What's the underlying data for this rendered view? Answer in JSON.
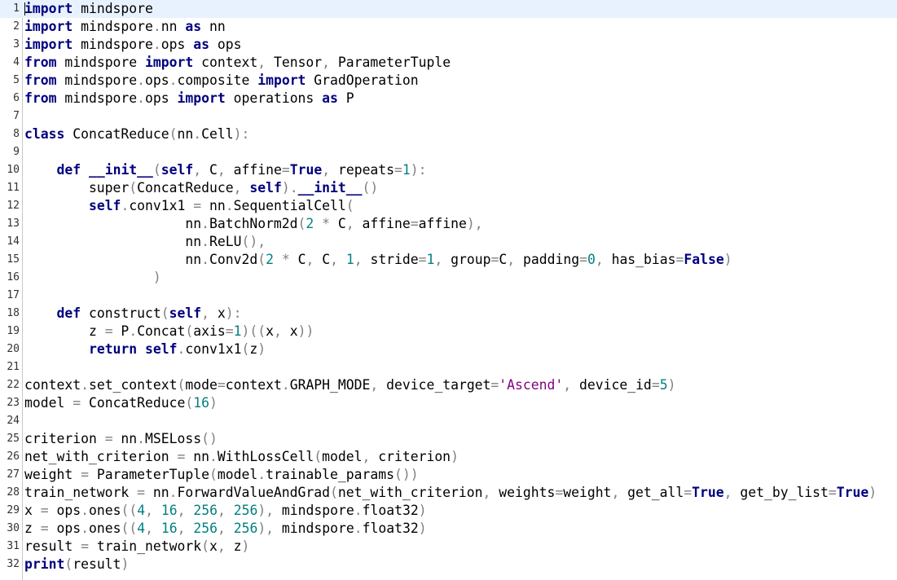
{
  "editor": {
    "current_line": 1,
    "colors": {
      "keyword": "#00007f",
      "operator": "#808080",
      "number": "#007f7f",
      "string": "#7f007f",
      "current_line_bg": "#e8f2fe"
    },
    "lines": [
      {
        "n": "1",
        "tokens": [
          [
            "kw",
            "import"
          ],
          [
            "pl",
            " mindspore"
          ]
        ]
      },
      {
        "n": "2",
        "tokens": [
          [
            "kw",
            "import"
          ],
          [
            "pl",
            " mindspore"
          ],
          [
            "op",
            "."
          ],
          [
            "pl",
            "nn "
          ],
          [
            "kw",
            "as"
          ],
          [
            "pl",
            " nn"
          ]
        ]
      },
      {
        "n": "3",
        "tokens": [
          [
            "kw",
            "import"
          ],
          [
            "pl",
            " mindspore"
          ],
          [
            "op",
            "."
          ],
          [
            "pl",
            "ops "
          ],
          [
            "kw",
            "as"
          ],
          [
            "pl",
            " ops"
          ]
        ]
      },
      {
        "n": "4",
        "tokens": [
          [
            "kw",
            "from"
          ],
          [
            "pl",
            " mindspore "
          ],
          [
            "kw",
            "import"
          ],
          [
            "pl",
            " context"
          ],
          [
            "op",
            ","
          ],
          [
            "pl",
            " Tensor"
          ],
          [
            "op",
            ","
          ],
          [
            "pl",
            " ParameterTuple"
          ]
        ]
      },
      {
        "n": "5",
        "tokens": [
          [
            "kw",
            "from"
          ],
          [
            "pl",
            " mindspore"
          ],
          [
            "op",
            "."
          ],
          [
            "pl",
            "ops"
          ],
          [
            "op",
            "."
          ],
          [
            "pl",
            "composite "
          ],
          [
            "kw",
            "import"
          ],
          [
            "pl",
            " GradOperation"
          ]
        ]
      },
      {
        "n": "6",
        "tokens": [
          [
            "kw",
            "from"
          ],
          [
            "pl",
            " mindspore"
          ],
          [
            "op",
            "."
          ],
          [
            "pl",
            "ops "
          ],
          [
            "kw",
            "import"
          ],
          [
            "pl",
            " operations "
          ],
          [
            "kw",
            "as"
          ],
          [
            "pl",
            " P"
          ]
        ]
      },
      {
        "n": "7",
        "tokens": []
      },
      {
        "n": "8",
        "tokens": [
          [
            "kw",
            "class"
          ],
          [
            "pl",
            " ConcatReduce"
          ],
          [
            "op",
            "("
          ],
          [
            "pl",
            "nn"
          ],
          [
            "op",
            "."
          ],
          [
            "pl",
            "Cell"
          ],
          [
            "op",
            "):"
          ]
        ]
      },
      {
        "n": "9",
        "tokens": []
      },
      {
        "n": "10",
        "tokens": [
          [
            "pl",
            "    "
          ],
          [
            "kw",
            "def"
          ],
          [
            "pl",
            " "
          ],
          [
            "kw",
            "__init__"
          ],
          [
            "op",
            "("
          ],
          [
            "kw",
            "self"
          ],
          [
            "op",
            ","
          ],
          [
            "pl",
            " C"
          ],
          [
            "op",
            ","
          ],
          [
            "pl",
            " affine"
          ],
          [
            "op",
            "="
          ],
          [
            "kw",
            "True"
          ],
          [
            "op",
            ","
          ],
          [
            "pl",
            " repeats"
          ],
          [
            "op",
            "="
          ],
          [
            "num",
            "1"
          ],
          [
            "op",
            "):"
          ]
        ]
      },
      {
        "n": "11",
        "tokens": [
          [
            "pl",
            "        super"
          ],
          [
            "op",
            "("
          ],
          [
            "pl",
            "ConcatReduce"
          ],
          [
            "op",
            ","
          ],
          [
            "pl",
            " "
          ],
          [
            "kw",
            "self"
          ],
          [
            "op",
            ")."
          ],
          [
            "kw",
            "__init__"
          ],
          [
            "op",
            "()"
          ]
        ]
      },
      {
        "n": "12",
        "tokens": [
          [
            "pl",
            "        "
          ],
          [
            "kw",
            "self"
          ],
          [
            "op",
            "."
          ],
          [
            "pl",
            "conv1x1 "
          ],
          [
            "op",
            "="
          ],
          [
            "pl",
            " nn"
          ],
          [
            "op",
            "."
          ],
          [
            "pl",
            "SequentialCell"
          ],
          [
            "op",
            "("
          ]
        ]
      },
      {
        "n": "13",
        "tokens": [
          [
            "pl",
            "                    nn"
          ],
          [
            "op",
            "."
          ],
          [
            "pl",
            "BatchNorm2d"
          ],
          [
            "op",
            "("
          ],
          [
            "num",
            "2"
          ],
          [
            "pl",
            " "
          ],
          [
            "op",
            "*"
          ],
          [
            "pl",
            " C"
          ],
          [
            "op",
            ","
          ],
          [
            "pl",
            " affine"
          ],
          [
            "op",
            "="
          ],
          [
            "pl",
            "affine"
          ],
          [
            "op",
            "),"
          ]
        ]
      },
      {
        "n": "14",
        "tokens": [
          [
            "pl",
            "                    nn"
          ],
          [
            "op",
            "."
          ],
          [
            "pl",
            "ReLU"
          ],
          [
            "op",
            "(),"
          ]
        ]
      },
      {
        "n": "15",
        "tokens": [
          [
            "pl",
            "                    nn"
          ],
          [
            "op",
            "."
          ],
          [
            "pl",
            "Conv2d"
          ],
          [
            "op",
            "("
          ],
          [
            "num",
            "2"
          ],
          [
            "pl",
            " "
          ],
          [
            "op",
            "*"
          ],
          [
            "pl",
            " C"
          ],
          [
            "op",
            ","
          ],
          [
            "pl",
            " C"
          ],
          [
            "op",
            ","
          ],
          [
            "pl",
            " "
          ],
          [
            "num",
            "1"
          ],
          [
            "op",
            ","
          ],
          [
            "pl",
            " stride"
          ],
          [
            "op",
            "="
          ],
          [
            "num",
            "1"
          ],
          [
            "op",
            ","
          ],
          [
            "pl",
            " group"
          ],
          [
            "op",
            "="
          ],
          [
            "pl",
            "C"
          ],
          [
            "op",
            ","
          ],
          [
            "pl",
            " padding"
          ],
          [
            "op",
            "="
          ],
          [
            "num",
            "0"
          ],
          [
            "op",
            ","
          ],
          [
            "pl",
            " has_bias"
          ],
          [
            "op",
            "="
          ],
          [
            "kw",
            "False"
          ],
          [
            "op",
            ")"
          ]
        ]
      },
      {
        "n": "16",
        "tokens": [
          [
            "pl",
            "                "
          ],
          [
            "op",
            ")"
          ]
        ]
      },
      {
        "n": "17",
        "tokens": []
      },
      {
        "n": "18",
        "tokens": [
          [
            "pl",
            "    "
          ],
          [
            "kw",
            "def"
          ],
          [
            "pl",
            " construct"
          ],
          [
            "op",
            "("
          ],
          [
            "kw",
            "self"
          ],
          [
            "op",
            ","
          ],
          [
            "pl",
            " x"
          ],
          [
            "op",
            "):"
          ]
        ]
      },
      {
        "n": "19",
        "tokens": [
          [
            "pl",
            "        z "
          ],
          [
            "op",
            "="
          ],
          [
            "pl",
            " P"
          ],
          [
            "op",
            "."
          ],
          [
            "pl",
            "Concat"
          ],
          [
            "op",
            "("
          ],
          [
            "pl",
            "axis"
          ],
          [
            "op",
            "="
          ],
          [
            "num",
            "1"
          ],
          [
            "op",
            ")(("
          ],
          [
            "pl",
            "x"
          ],
          [
            "op",
            ","
          ],
          [
            "pl",
            " x"
          ],
          [
            "op",
            "))"
          ]
        ]
      },
      {
        "n": "20",
        "tokens": [
          [
            "pl",
            "        "
          ],
          [
            "kw",
            "return"
          ],
          [
            "pl",
            " "
          ],
          [
            "kw",
            "self"
          ],
          [
            "op",
            "."
          ],
          [
            "pl",
            "conv1x1"
          ],
          [
            "op",
            "("
          ],
          [
            "pl",
            "z"
          ],
          [
            "op",
            ")"
          ]
        ]
      },
      {
        "n": "21",
        "tokens": []
      },
      {
        "n": "22",
        "tokens": [
          [
            "pl",
            "context"
          ],
          [
            "op",
            "."
          ],
          [
            "pl",
            "set_context"
          ],
          [
            "op",
            "("
          ],
          [
            "pl",
            "mode"
          ],
          [
            "op",
            "="
          ],
          [
            "pl",
            "context"
          ],
          [
            "op",
            "."
          ],
          [
            "pl",
            "GRAPH_MODE"
          ],
          [
            "op",
            ","
          ],
          [
            "pl",
            " device_target"
          ],
          [
            "op",
            "="
          ],
          [
            "str",
            "'Ascend'"
          ],
          [
            "op",
            ","
          ],
          [
            "pl",
            " device_id"
          ],
          [
            "op",
            "="
          ],
          [
            "num",
            "5"
          ],
          [
            "op",
            ")"
          ]
        ]
      },
      {
        "n": "23",
        "tokens": [
          [
            "pl",
            "model "
          ],
          [
            "op",
            "="
          ],
          [
            "pl",
            " ConcatReduce"
          ],
          [
            "op",
            "("
          ],
          [
            "num",
            "16"
          ],
          [
            "op",
            ")"
          ]
        ]
      },
      {
        "n": "24",
        "tokens": []
      },
      {
        "n": "25",
        "tokens": [
          [
            "pl",
            "criterion "
          ],
          [
            "op",
            "="
          ],
          [
            "pl",
            " nn"
          ],
          [
            "op",
            "."
          ],
          [
            "pl",
            "MSELoss"
          ],
          [
            "op",
            "()"
          ]
        ]
      },
      {
        "n": "26",
        "tokens": [
          [
            "pl",
            "net_with_criterion "
          ],
          [
            "op",
            "="
          ],
          [
            "pl",
            " nn"
          ],
          [
            "op",
            "."
          ],
          [
            "pl",
            "WithLossCell"
          ],
          [
            "op",
            "("
          ],
          [
            "pl",
            "model"
          ],
          [
            "op",
            ","
          ],
          [
            "pl",
            " criterion"
          ],
          [
            "op",
            ")"
          ]
        ]
      },
      {
        "n": "27",
        "tokens": [
          [
            "pl",
            "weight "
          ],
          [
            "op",
            "="
          ],
          [
            "pl",
            " ParameterTuple"
          ],
          [
            "op",
            "("
          ],
          [
            "pl",
            "model"
          ],
          [
            "op",
            "."
          ],
          [
            "pl",
            "trainable_params"
          ],
          [
            "op",
            "())"
          ]
        ]
      },
      {
        "n": "28",
        "tokens": [
          [
            "pl",
            "train_network "
          ],
          [
            "op",
            "="
          ],
          [
            "pl",
            " nn"
          ],
          [
            "op",
            "."
          ],
          [
            "pl",
            "ForwardValueAndGrad"
          ],
          [
            "op",
            "("
          ],
          [
            "pl",
            "net_with_criterion"
          ],
          [
            "op",
            ","
          ],
          [
            "pl",
            " weights"
          ],
          [
            "op",
            "="
          ],
          [
            "pl",
            "weight"
          ],
          [
            "op",
            ","
          ],
          [
            "pl",
            " get_all"
          ],
          [
            "op",
            "="
          ],
          [
            "kw",
            "True"
          ],
          [
            "op",
            ","
          ],
          [
            "pl",
            " get_by_list"
          ],
          [
            "op",
            "="
          ],
          [
            "kw",
            "True"
          ],
          [
            "op",
            ")"
          ]
        ]
      },
      {
        "n": "29",
        "tokens": [
          [
            "pl",
            "x "
          ],
          [
            "op",
            "="
          ],
          [
            "pl",
            " ops"
          ],
          [
            "op",
            "."
          ],
          [
            "pl",
            "ones"
          ],
          [
            "op",
            "(("
          ],
          [
            "num",
            "4"
          ],
          [
            "op",
            ","
          ],
          [
            "pl",
            " "
          ],
          [
            "num",
            "16"
          ],
          [
            "op",
            ","
          ],
          [
            "pl",
            " "
          ],
          [
            "num",
            "256"
          ],
          [
            "op",
            ","
          ],
          [
            "pl",
            " "
          ],
          [
            "num",
            "256"
          ],
          [
            "op",
            "),"
          ],
          [
            "pl",
            " mindspore"
          ],
          [
            "op",
            "."
          ],
          [
            "pl",
            "float32"
          ],
          [
            "op",
            ")"
          ]
        ]
      },
      {
        "n": "30",
        "tokens": [
          [
            "pl",
            "z "
          ],
          [
            "op",
            "="
          ],
          [
            "pl",
            " ops"
          ],
          [
            "op",
            "."
          ],
          [
            "pl",
            "ones"
          ],
          [
            "op",
            "(("
          ],
          [
            "num",
            "4"
          ],
          [
            "op",
            ","
          ],
          [
            "pl",
            " "
          ],
          [
            "num",
            "16"
          ],
          [
            "op",
            ","
          ],
          [
            "pl",
            " "
          ],
          [
            "num",
            "256"
          ],
          [
            "op",
            ","
          ],
          [
            "pl",
            " "
          ],
          [
            "num",
            "256"
          ],
          [
            "op",
            "),"
          ],
          [
            "pl",
            " mindspore"
          ],
          [
            "op",
            "."
          ],
          [
            "pl",
            "float32"
          ],
          [
            "op",
            ")"
          ]
        ]
      },
      {
        "n": "31",
        "tokens": [
          [
            "pl",
            "result "
          ],
          [
            "op",
            "="
          ],
          [
            "pl",
            " train_network"
          ],
          [
            "op",
            "("
          ],
          [
            "pl",
            "x"
          ],
          [
            "op",
            ","
          ],
          [
            "pl",
            " z"
          ],
          [
            "op",
            ")"
          ]
        ]
      },
      {
        "n": "32",
        "tokens": [
          [
            "kw",
            "print"
          ],
          [
            "op",
            "("
          ],
          [
            "pl",
            "result"
          ],
          [
            "op",
            ")"
          ]
        ]
      }
    ]
  }
}
